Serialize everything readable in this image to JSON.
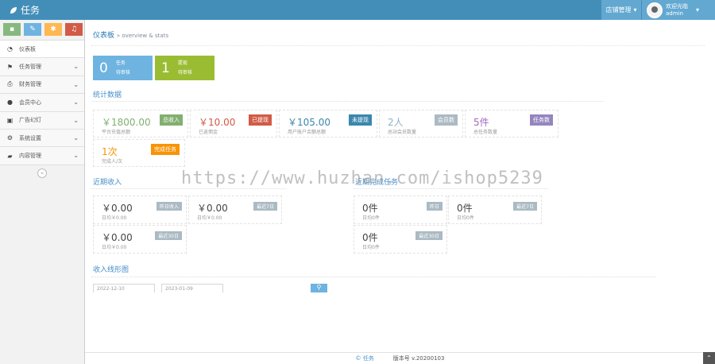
{
  "header": {
    "app_title": "任务",
    "store_label": "店铺管理",
    "welcome": "欢迎光临",
    "username": "admin"
  },
  "sidebar": {
    "items": [
      {
        "label": "仪表板",
        "icon": "dashboard-icon",
        "glyph": "◔"
      },
      {
        "label": "任务管理",
        "icon": "flag-icon",
        "glyph": "⚑"
      },
      {
        "label": "财务管理",
        "icon": "print-icon",
        "glyph": "⎙"
      },
      {
        "label": "会员中心",
        "icon": "user-icon",
        "glyph": "●"
      },
      {
        "label": "广告幻灯",
        "icon": "picture-icon",
        "glyph": "▣"
      },
      {
        "label": "系统设置",
        "icon": "cog-icon",
        "glyph": "⚙"
      },
      {
        "label": "内容管理",
        "icon": "folder-icon",
        "glyph": "▰"
      }
    ]
  },
  "breadcrumb": {
    "title": "仪表板",
    "sub": "» overview & stats"
  },
  "cards": [
    {
      "num": "0",
      "l1": "任务",
      "l2": "待审核",
      "color": "#6fb3e0"
    },
    {
      "num": "1",
      "l1": "提现",
      "l2": "待审核",
      "color": "#9abc32"
    }
  ],
  "stats": {
    "title": "统计数据",
    "items": [
      {
        "value": "￥1800.00",
        "sub": "平台充值总额",
        "tag": "总收入",
        "tcls": "green",
        "vcolor": "#82af6f"
      },
      {
        "value": "￥10.00",
        "sub": "已返佣金",
        "tag": "已提现",
        "tcls": "red",
        "vcolor": "#d15b47"
      },
      {
        "value": "￥105.00",
        "sub": "用户账户余额总额",
        "tag": "未提现",
        "tcls": "blue",
        "vcolor": "#3a87ad"
      },
      {
        "value": "2人",
        "sub": "总站会员数量",
        "tag": "会员数",
        "tcls": "grey",
        "vcolor": "#8cb2c9"
      },
      {
        "value": "5件",
        "sub": "总任务数量",
        "tag": "任务数",
        "tcls": "purple",
        "vcolor": "#a069c3"
      },
      {
        "value": "1次",
        "sub": "完成人/次",
        "tag": "完成任务",
        "tcls": "orange",
        "vcolor": "#f89406"
      }
    ]
  },
  "income": {
    "title": "近期收入",
    "items": [
      {
        "value": "￥0.00",
        "sub": "日均￥0.00",
        "tag": "昨日收入"
      },
      {
        "value": "￥0.00",
        "sub": "日均￥0.00",
        "tag": "最近7日"
      },
      {
        "value": "￥0.00",
        "sub": "日均￥0.00",
        "tag": "最近30日"
      }
    ]
  },
  "tasks": {
    "title": "近期完成任务",
    "items": [
      {
        "value": "0件",
        "sub": "日均0件",
        "tag": "昨日"
      },
      {
        "value": "0件",
        "sub": "日均0件",
        "tag": "最近7日"
      },
      {
        "value": "0件",
        "sub": "日均0件",
        "tag": "最近30日"
      }
    ]
  },
  "chart": {
    "title": "收入线形图",
    "date_from": "2022-12-10",
    "date_to": "2023-01-09"
  },
  "footer": {
    "copyright": "© 任务",
    "version": "版本号 v.20200103"
  },
  "watermark": "https://www.huzhan.com/ishop5239",
  "colors": {
    "topbar": "#438eb9",
    "accent": "#62a8d1"
  }
}
